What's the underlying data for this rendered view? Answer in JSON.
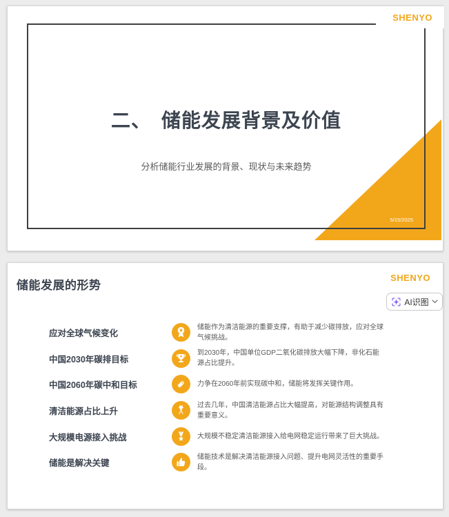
{
  "brand": {
    "logo_text": "SHENYO"
  },
  "colors": {
    "accent_orange": "#F2A71B",
    "title_dark": "#3C4450",
    "body_gray": "#595959",
    "frame_border": "#3f3f3f",
    "ai_sparkle_purple": "#7C5CF0",
    "page_background": "#ececec"
  },
  "slide1": {
    "title": "二、　储能发展背景及价值",
    "subtitle": "分析储能行业发展的背景、现状与未来趋势",
    "date": "5/15/2025"
  },
  "slide2": {
    "title": "储能发展的形势",
    "ai_button": {
      "label": "AI识图",
      "icon": "ai-scan-sparkle-icon",
      "chevron": "chevron-down-icon"
    },
    "items": [
      {
        "label": "应对全球气候变化",
        "icon": "award-ribbon-icon",
        "desc": "储能作为清洁能源的重要支撑，有助于减少碳排放，应对全球气候挑战。"
      },
      {
        "label": "中国2030年碳排目标",
        "icon": "trophy-icon",
        "desc": "到2030年，中国单位GDP二氧化碳排放大幅下降，非化石能源占比提升。"
      },
      {
        "label": "中国2060年碳中和目标",
        "icon": "tag-icon",
        "desc": "力争在2060年前实现碳中和，储能将发挥关键作用。"
      },
      {
        "label": "清洁能源占比上升",
        "icon": "crossed-flags-icon",
        "desc": "过去几年，中国清洁能源占比大幅提高，对能源结构调整具有重要意义。"
      },
      {
        "label": "大规模电源接入挑战",
        "icon": "medal-star-icon",
        "desc": "大规模不稳定清洁能源接入给电网稳定运行带来了巨大挑战。"
      },
      {
        "label": "储能是解决关键",
        "icon": "thumbs-up-icon",
        "desc": "储能技术是解决清洁能源接入问题、提升电网灵活性的重要手段。"
      }
    ]
  }
}
